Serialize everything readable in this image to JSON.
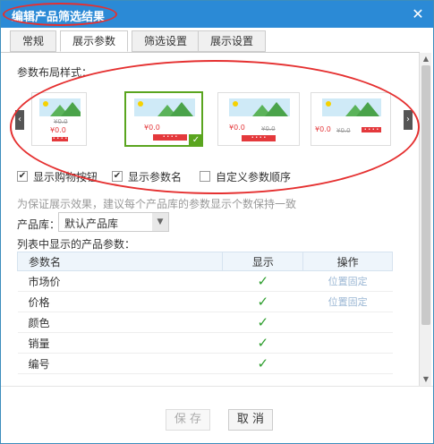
{
  "dialog": {
    "title": "编辑产品筛选结果",
    "close_glyph": "✕"
  },
  "tabs": [
    {
      "label": "常规"
    },
    {
      "label": "展示参数",
      "active": true
    },
    {
      "label": "筛选设置"
    },
    {
      "label": "展示设置"
    }
  ],
  "layout_section": {
    "label": "参数布局样式：",
    "prev_glyph": "‹",
    "next_glyph": "›",
    "cards": [
      {
        "old_price": "¥0.0",
        "price": "¥0.0",
        "buy_label": "• • • •",
        "selected": false
      },
      {
        "old_price": "",
        "price": "¥0.0",
        "buy_label": "• • • •",
        "selected": true
      },
      {
        "old_price": "¥0.0",
        "price": "¥0.0",
        "buy_label": "• • • •",
        "selected": false
      },
      {
        "old_price": "¥0.0",
        "price": "¥0.0",
        "buy_label": "• • • •",
        "selected": false
      }
    ]
  },
  "options": {
    "show_buy_button": {
      "label": "显示购物按钮",
      "checked": true
    },
    "show_param_name": {
      "label": "显示参数名",
      "checked": true
    },
    "custom_order": {
      "label": "自定义参数顺序",
      "checked": false
    }
  },
  "hint": "为保证展示效果，建议每个产品库的参数显示个数保持一致",
  "product_lib": {
    "label": "产品库：",
    "value": "默认产品库",
    "chevron": "▼"
  },
  "param_list": {
    "label": "列表中显示的产品参数：",
    "headers": {
      "name": "参数名",
      "show": "显示",
      "action": "操作"
    },
    "rows": [
      {
        "name": "市场价",
        "show": "✓",
        "action": "位置固定"
      },
      {
        "name": "价格",
        "show": "✓",
        "action": "位置固定"
      },
      {
        "name": "颜色",
        "show": "✓",
        "action": ""
      },
      {
        "name": "销量",
        "show": "✓",
        "action": ""
      },
      {
        "name": "编号",
        "show": "✓",
        "action": ""
      }
    ]
  },
  "footer": {
    "save_label": "保 存",
    "cancel_label": "取 消"
  },
  "colors": {
    "titlebar": "#2b8ad6",
    "price_red": "#e4393c",
    "check_green": "#2e9e2e",
    "annotation": "#e53030"
  }
}
